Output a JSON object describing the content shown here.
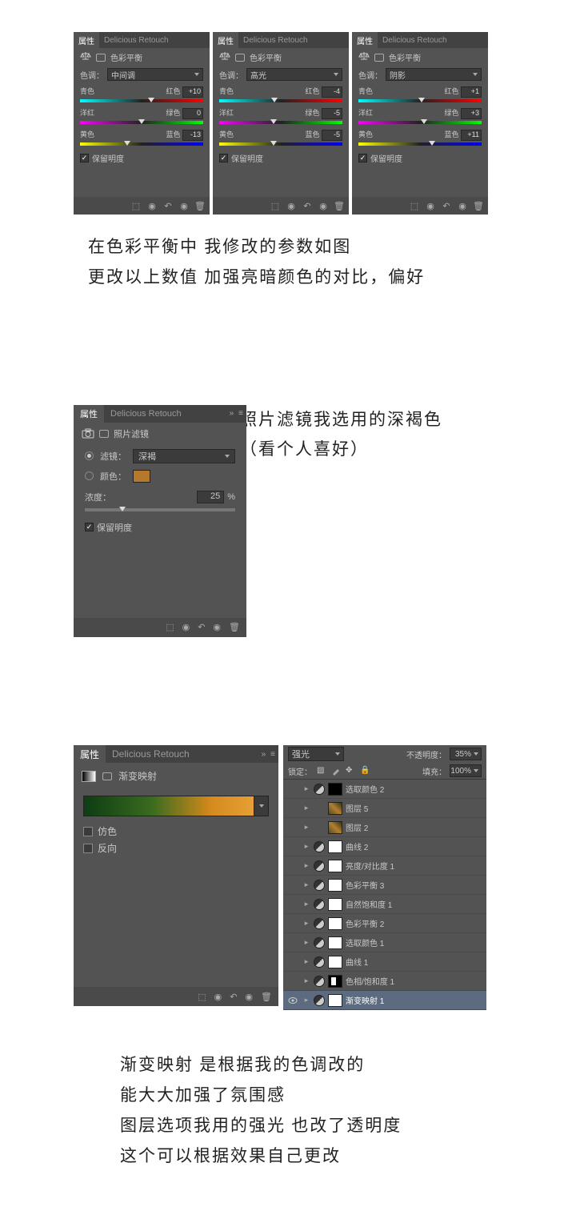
{
  "panel_common": {
    "tab_props": "属性",
    "tab_dr": "Delicious Retouch",
    "preserve_lum": "保留明度",
    "foot_expand": "»"
  },
  "cb_icon_label": "色彩平衡",
  "cb_tone_label": "色调：",
  "cb_labels": {
    "cyan": "青色",
    "red": "红色",
    "magenta": "洋红",
    "green": "绿色",
    "yellow": "黄色",
    "blue": "蓝色"
  },
  "color_balance": [
    {
      "tone": "中间调",
      "vals": [
        "+10",
        "0",
        "-13"
      ],
      "thumbs": [
        58,
        50,
        38
      ]
    },
    {
      "tone": "高光",
      "vals": [
        "-4",
        "-5",
        "-5"
      ],
      "thumbs": [
        45,
        44,
        44
      ]
    },
    {
      "tone": "阴影",
      "vals": [
        "+1",
        "+3",
        "+11"
      ],
      "thumbs": [
        51,
        53,
        60
      ]
    }
  ],
  "annotation1_l1": "在色彩平衡中  我修改的参数如图",
  "annotation1_l2": "更改以上数值  加强亮暗颜色的对比，偏好",
  "photo_filter": {
    "title": "照片滤镜",
    "filter_label": "滤镜：",
    "filter_value": "深褐",
    "color_label": "颜色：",
    "density_label": "浓度：",
    "density_value": "25",
    "density_unit": "%",
    "density_thumb": 25
  },
  "annotation2_l1": "照片滤镜我选用的深褐色",
  "annotation2_l2": "（看个人喜好）",
  "grad_map": {
    "title": "渐变映射",
    "dither": "仿色",
    "reverse": "反向"
  },
  "layers": {
    "blend_mode": "强光",
    "opacity_label": "不透明度：",
    "opacity_value": "35%",
    "lock_label": "锁定：",
    "fill_label": "填充：",
    "fill_value": "100%",
    "items": [
      {
        "name": "选取颜色 2",
        "thumb": "mask-black",
        "adj": true
      },
      {
        "name": "图层 5",
        "thumb": "img",
        "adj": false
      },
      {
        "name": "图层 2",
        "thumb": "img",
        "adj": false
      },
      {
        "name": "曲线 2",
        "thumb": "mask",
        "adj": true
      },
      {
        "name": "亮度/对比度 1",
        "thumb": "mask",
        "adj": true
      },
      {
        "name": "色彩平衡 3",
        "thumb": "mask",
        "adj": true
      },
      {
        "name": "自然饱和度 1",
        "thumb": "mask",
        "adj": true
      },
      {
        "name": "色彩平衡 2",
        "thumb": "mask",
        "adj": true
      },
      {
        "name": "选取颜色 1",
        "thumb": "mask",
        "adj": true
      },
      {
        "name": "曲线 1",
        "thumb": "mask",
        "adj": true
      },
      {
        "name": "色相/饱和度 1",
        "thumb": "mask-bw",
        "adj": true
      },
      {
        "name": "渐变映射 1",
        "thumb": "mask",
        "adj": true,
        "selected": true,
        "visible": true
      }
    ]
  },
  "annotation3_l1": "渐变映射 是根据我的色调改的",
  "annotation3_l2": "能大大加强了氛围感",
  "annotation3_l3": "图层选项我用的强光 也改了透明度",
  "annotation3_l4": "这个可以根据效果自己更改"
}
